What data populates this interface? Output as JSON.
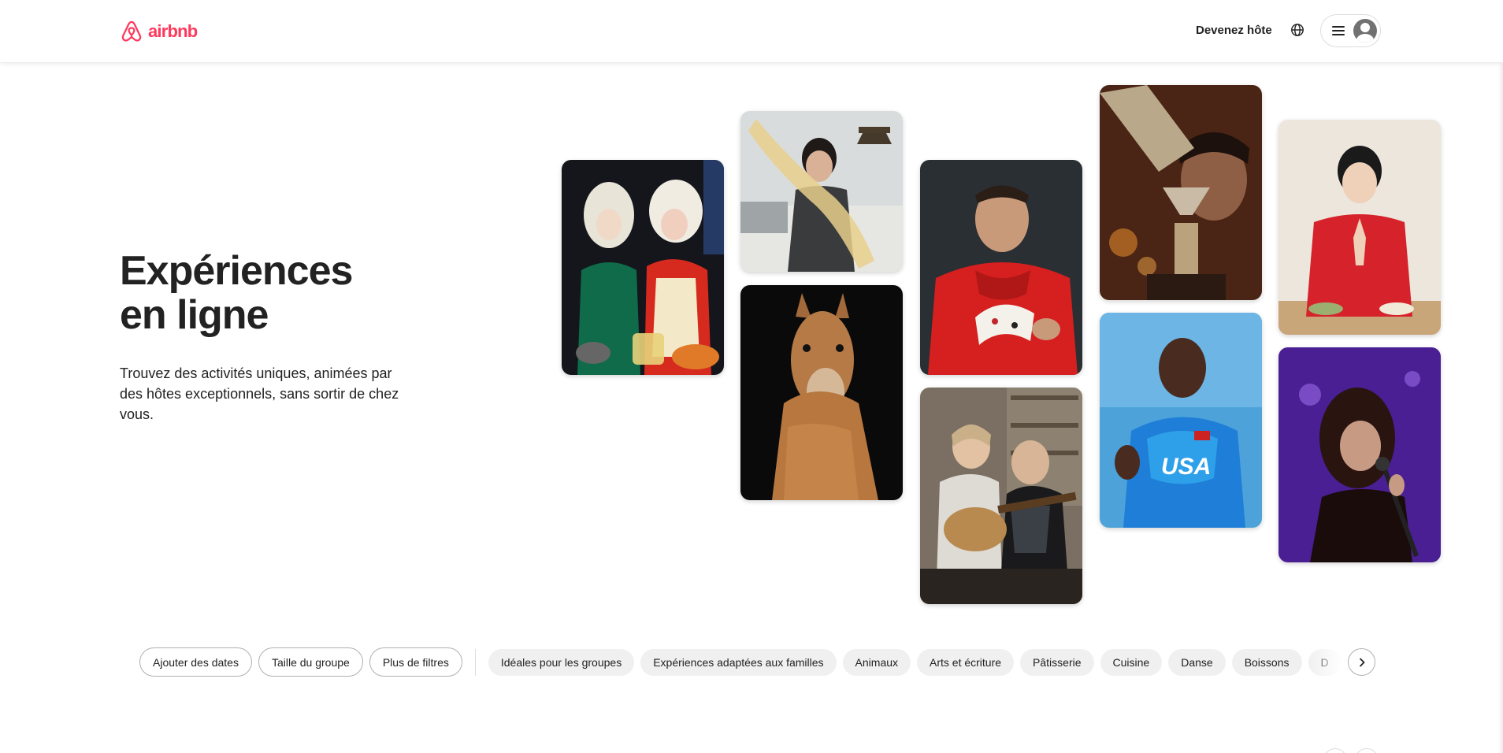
{
  "header": {
    "logo_text": "airbnb",
    "brand_color": "#FF385C",
    "host_link": "Devenez hôte",
    "globe_icon": "globe-icon",
    "menu_icon": "hamburger-icon",
    "avatar_icon": "user-avatar-icon"
  },
  "hero": {
    "title_line1": "Expériences",
    "title_line2": "en ligne",
    "subtitle": "Trouvez des activités uniques, animées par des hôtes exceptionnels, sans sortir de chez vous."
  },
  "photos": [
    {
      "subject": "drag-queens-cooking"
    },
    {
      "subject": "pastry-chef-dough"
    },
    {
      "subject": "llama-portrait"
    },
    {
      "subject": "magician-with-cards"
    },
    {
      "subject": "guitar-lesson-couple"
    },
    {
      "subject": "bartender-pouring-cocktail"
    },
    {
      "subject": "olympic-athlete-usa"
    },
    {
      "subject": "meditation-host"
    },
    {
      "subject": "singer-with-microphone"
    }
  ],
  "filters": {
    "primary": [
      "Ajouter des dates",
      "Taille du groupe",
      "Plus de filtres"
    ],
    "categories": [
      "Idéales pour les groupes",
      "Expériences adaptées aux familles",
      "Animaux",
      "Arts et écriture",
      "Pâtisserie",
      "Cuisine",
      "Danse",
      "Boissons",
      "D"
    ],
    "next_icon": "chevron-right-icon"
  }
}
